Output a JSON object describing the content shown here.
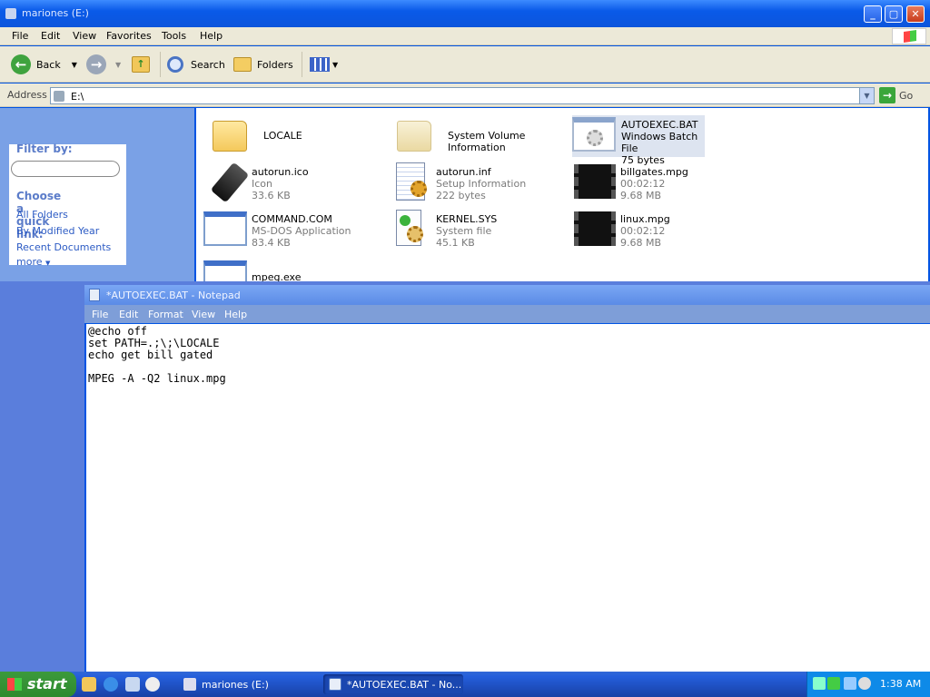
{
  "explorer": {
    "title": "mariones (E:)",
    "menu": [
      "File",
      "Edit",
      "View",
      "Favorites",
      "Tools",
      "Help"
    ],
    "toolbar": {
      "back": "Back",
      "search": "Search",
      "folders": "Folders"
    },
    "address": {
      "label": "Address",
      "value": "E:\\",
      "go": "Go"
    },
    "left_pane": {
      "filter_heading": "Filter by:",
      "quick_link_heading": "Choose a quick link:",
      "links": [
        "All Folders",
        "By Modified Year",
        "Recent Documents",
        "more"
      ]
    },
    "items": [
      {
        "name": "LOCALE",
        "type": "",
        "size": "",
        "icon": "folder-icon"
      },
      {
        "name": "System Volume Information",
        "type": "",
        "size": "",
        "icon": "folder-icon"
      },
      {
        "name": "AUTOEXEC.BAT",
        "type": "Windows Batch File",
        "size": "75 bytes",
        "icon": "batch-file-icon"
      },
      {
        "name": "autorun.ico",
        "type": "Icon",
        "size": "33.6 KB",
        "icon": "usb-drive-icon"
      },
      {
        "name": "autorun.inf",
        "type": "Setup Information",
        "size": "222 bytes",
        "icon": "setup-info-icon"
      },
      {
        "name": "billgates.mpg",
        "type": "00:02:12",
        "size": "9.68 MB",
        "icon": "video-file-icon"
      },
      {
        "name": "COMMAND.COM",
        "type": "MS-DOS Application",
        "size": "83.4 KB",
        "icon": "application-icon"
      },
      {
        "name": "KERNEL.SYS",
        "type": "System file",
        "size": "45.1 KB",
        "icon": "system-file-icon"
      },
      {
        "name": "linux.mpg",
        "type": "00:02:12",
        "size": "9.68 MB",
        "icon": "video-file-icon"
      },
      {
        "name": "mpeg.exe",
        "type": "",
        "size": "",
        "icon": "application-icon"
      }
    ]
  },
  "notepad": {
    "title": "*AUTOEXEC.BAT - Notepad",
    "menu": [
      "File",
      "Edit",
      "Format",
      "View",
      "Help"
    ],
    "text": "@echo off\nset PATH=.;\\;\\LOCALE\necho get bill gated\n\nMPEG -A -Q2 linux.mpg"
  },
  "taskbar": {
    "start": "start",
    "tasks": [
      "mariones (E:)",
      "*AUTOEXEC.BAT - No..."
    ],
    "clock": "1:38 AM"
  }
}
